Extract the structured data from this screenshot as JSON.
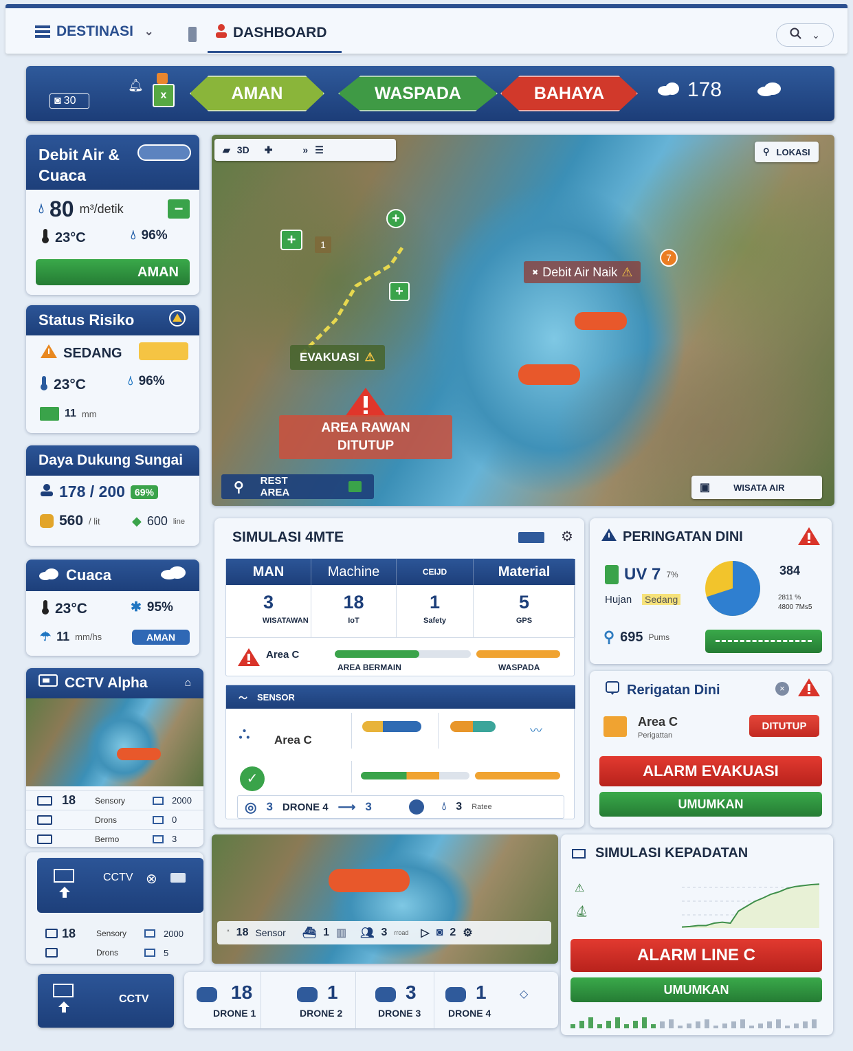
{
  "nav": {
    "destinasi": "DESTINASI",
    "dashboard": "DASHBOARD"
  },
  "status_bar": {
    "counter": "30",
    "levels": [
      {
        "label": "AMAN",
        "color": "#8ab53a"
      },
      {
        "label": "WASPADA",
        "color": "#3f9a45"
      },
      {
        "label": "BAHAYA",
        "color": "#d1392b"
      }
    ],
    "weather_value": "178"
  },
  "debit": {
    "title_1": "Debit Air &",
    "title_2": "Cuaca",
    "flow": "80",
    "flow_unit": "m³/detik",
    "temp": "23°C",
    "humidity": "96%",
    "status": "AMAN"
  },
  "risk": {
    "title": "Status Risiko",
    "level": "SEDANG",
    "temp": "23°C",
    "humidity": "96%",
    "rain": "11",
    "rain_unit": "mm"
  },
  "capacity": {
    "title": "Daya Dukung Sungai",
    "visitors": "178 / 200",
    "percent": "69%",
    "water": "560",
    "water_unit": "/ lit",
    "water_max": "600",
    "water_max_unit": "line"
  },
  "weather": {
    "title": "Cuaca",
    "temp": "23°C",
    "humidity": "95%",
    "rain": "11",
    "rain_unit": "mm/hs",
    "status": "AMAN"
  },
  "cctv_alpha": {
    "title": "CCTV Alpha",
    "rows": [
      {
        "v1": "18",
        "l1": "Sensory",
        "v2": "2000"
      },
      {
        "v1": "",
        "l1": "Drons",
        "v2": "0"
      },
      {
        "v1": "",
        "l1": "Bermo",
        "v2": "3"
      }
    ]
  },
  "cctv2": {
    "title": "CCTV",
    "rows": [
      {
        "v1": "18",
        "l1": "Sensory",
        "v2": "2000"
      },
      {
        "v1": "",
        "l1": "Drons",
        "v2": "5"
      }
    ]
  },
  "cctv3": {
    "title": "CCTV"
  },
  "map": {
    "toolbar_3d": "3D",
    "lokasi": "LOKASI",
    "debit_naik": "Debit Air Naik",
    "badge_num": "7",
    "evakuasi": "EVAKUASI",
    "area_1": "AREA RAWAN",
    "area_2": "DITUTUP",
    "rest_area": "REST AREA",
    "wisata_air": "WISATA AIR",
    "marker_num": "1"
  },
  "sim": {
    "title": "SIMULASI 4MTE",
    "cols": [
      "MAN",
      "Machine",
      "CEIJD",
      "Material"
    ],
    "cells": [
      {
        "v": "3",
        "l": "WISATAWAN"
      },
      {
        "v": "18",
        "l": "IoT"
      },
      {
        "v": "1",
        "l": "Safety"
      },
      {
        "v": "5",
        "l": "GPS"
      }
    ],
    "area": "Area C",
    "bar1": "AREA BERMAIN",
    "bar2": "WASPADA",
    "sensor_title": "SENSOR",
    "sensor_area": "Area C",
    "drone_a": "3",
    "drone_label": "DRONE 4",
    "drone_b": "3",
    "rate": "3",
    "rate_label": "Ratee"
  },
  "early": {
    "title": "PERINGATAN DINI",
    "uv": "UV 7",
    "uv_sup": "7%",
    "rain_label": "Hujan",
    "rain_level": "Sedang",
    "top": "384",
    "p1": "2811 %",
    "p2": "4800 7Ms5",
    "pums": "695",
    "pums_label": "Pums",
    "pie_fraction": 0.7
  },
  "rerig": {
    "title": "Rerigatan Dini",
    "area": "Area C",
    "sub": "Perigattan",
    "tag": "DITUTUP",
    "alarm": "ALARM EVAKUASI",
    "announce": "UMUMKAN"
  },
  "river_strip": {
    "v1": "18",
    "l1": "Sensor",
    "v2": "1",
    "v3": "3",
    "l3": "rroad",
    "v4": "2"
  },
  "density": {
    "title": "SIMULASI KEPADATAN",
    "alarm": "ALARM LINE C",
    "announce": "UMUMKAN",
    "series": [
      0.02,
      0.03,
      0.05,
      0.05,
      0.1,
      0.12,
      0.1,
      0.35,
      0.45,
      0.55,
      0.62,
      0.7,
      0.75,
      0.82,
      0.86,
      0.88,
      0.9,
      0.91
    ]
  },
  "drones": [
    {
      "v": "18",
      "l": "DRONE 1"
    },
    {
      "v": "1",
      "l": "DRONE 2"
    },
    {
      "v": "3",
      "l": "DRONE 3"
    },
    {
      "v": "1",
      "l": "DRONE 4"
    }
  ]
}
